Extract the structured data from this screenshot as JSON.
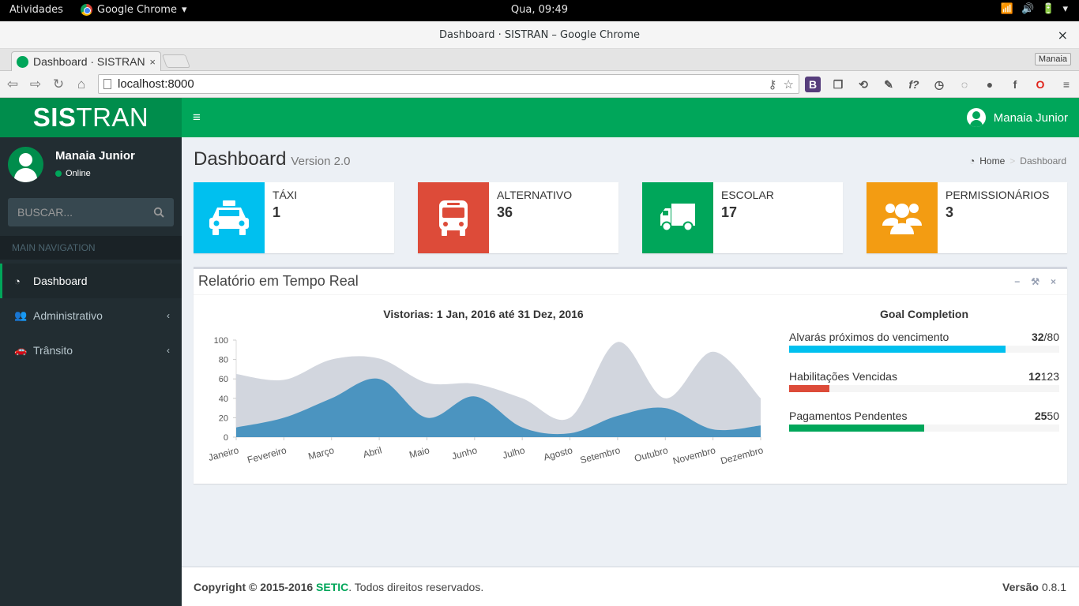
{
  "system": {
    "activities": "Atividades",
    "app_name": "Google Chrome",
    "clock": "Qua, 09:49"
  },
  "window": {
    "title": "Dashboard · SISTRAN – Google Chrome",
    "close": "×"
  },
  "tabs": [
    {
      "title": "Dashboard · SISTRAN",
      "close": "×"
    }
  ],
  "profile": "Manaia",
  "toolbar": {
    "url": "localhost:8000"
  },
  "app": {
    "logo_bold": "SIS",
    "logo_rest": "TRAN",
    "toggle": "≡",
    "user_name": "Manaia Junior"
  },
  "sidebar": {
    "user_name": "Manaia Junior",
    "status": "Online",
    "search_placeholder": "BUSCAR...",
    "section": "MAIN NAVIGATION",
    "items": [
      {
        "label": "Dashboard",
        "active": true
      },
      {
        "label": "Administrativo",
        "chevron": "‹"
      },
      {
        "label": "Trânsito",
        "chevron": "‹"
      }
    ]
  },
  "page": {
    "title": "Dashboard",
    "subtitle": "Version 2.0",
    "breadcrumb": [
      "Home",
      "Dashboard"
    ],
    "breadcrumb_sep": ">"
  },
  "info_boxes": [
    {
      "label": "TÁXI",
      "value": "1",
      "color": "#00c0ef",
      "icon": "taxi-icon"
    },
    {
      "label": "ALTERNATIVO",
      "value": "36",
      "color": "#dd4b39",
      "icon": "bus-icon"
    },
    {
      "label": "ESCOLAR",
      "value": "17",
      "color": "#00a65a",
      "icon": "truck-icon"
    },
    {
      "label": "PERMISSIONÁRIOS",
      "value": "3",
      "color": "#f39c12",
      "icon": "users-icon"
    }
  ],
  "report": {
    "title": "Relatório em Tempo Real",
    "tools": [
      "−",
      "🔧",
      "×"
    ],
    "goal_title": "Goal Completion",
    "goals": [
      {
        "label": "Alvarás próximos do vencimento",
        "value_bold": "32",
        "value_rest": "/80",
        "percent": 80,
        "color": "#00c0ef"
      },
      {
        "label": "Habilitações Vencidas",
        "value_bold": "12",
        "value_rest": "123",
        "percent": 15,
        "color": "#dd4b39"
      },
      {
        "label": "Pagamentos Pendentes",
        "value_bold": "25",
        "value_rest": "50",
        "percent": 50,
        "color": "#00a65a"
      }
    ]
  },
  "chart_data": {
    "type": "area",
    "title": "Vistorias: 1 Jan, 2016 até 31 Dez, 2016",
    "categories": [
      "Janeiro",
      "Fevereiro",
      "Março",
      "Abril",
      "Maio",
      "Junho",
      "Julho",
      "Agosto",
      "Setembro",
      "Outubro",
      "Novembro",
      "Dezembro"
    ],
    "ylim": [
      0,
      100
    ],
    "yticks": [
      0,
      20,
      40,
      60,
      80,
      100
    ],
    "series": [
      {
        "values": [
          65,
          59,
          80,
          81,
          56,
          55,
          40,
          20,
          98,
          40,
          88,
          40
        ],
        "color": "#d2d6de"
      },
      {
        "values": [
          10,
          20,
          40,
          60,
          20,
          42,
          10,
          4,
          22,
          30,
          8,
          12
        ],
        "color": "#3c8dbc"
      }
    ]
  },
  "footer": {
    "copyright": "Copyright © 2015-2016",
    "brand": "SETIC",
    "rights": ". Todos direitos reservados.",
    "version_label": "Versão",
    "version": "0.8.1"
  }
}
